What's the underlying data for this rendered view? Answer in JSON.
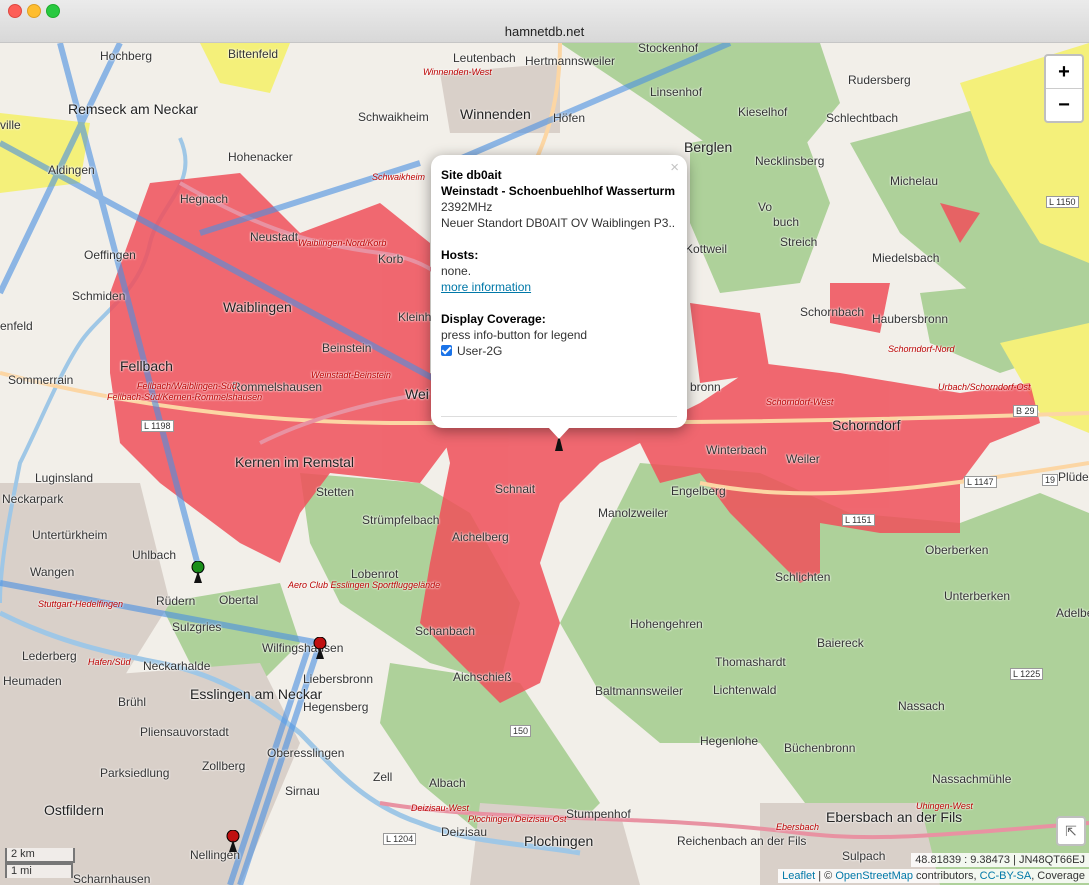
{
  "window": {
    "title": "hamnetdb.net"
  },
  "map": {
    "zoom_in": "+",
    "zoom_out": "−",
    "fullscreen_icon": "expand-icon",
    "places": [
      "Hochberg",
      "Bittenfeld",
      "Leutenbach",
      "Hertmannsweiler",
      "Stockenhof",
      "Rudersberg",
      "Remseck am Neckar",
      "Winnenden",
      "Höfen",
      "Linsenhof",
      "Kieselhof",
      "Schlechtbach",
      "Schwaikheim",
      "Berglen",
      "Necklinsberg",
      "Aldingen",
      "Hohenacker",
      "Michelau",
      "Hegnach",
      "Neustadt",
      "Oeffingen",
      "Schmiden",
      "Waiblingen",
      "Korb",
      "Streich",
      "Miedelsbach",
      "Vo",
      "buch",
      "Kottweil",
      "Kleinh",
      "Schornbach",
      "Haubersbronn",
      "Sommerrain",
      "Fellbach",
      "Beinstein",
      "Rommelshausen",
      "Wei",
      "bronn",
      "Schorndorf",
      "Kernen im Remstal",
      "Winterbach",
      "Weiler",
      "Luginsland",
      "Stetten",
      "Schnait",
      "Engelberg",
      "Untertürkheim",
      "Strümpfelbach",
      "Manolzweiler",
      "Oberberken",
      "Uhlbach",
      "Aichelberg",
      "Schlichten",
      "Wangen",
      "Lobenrot",
      "Rüdern",
      "Obertal",
      "Unterberken",
      "Sulzgries",
      "Hohengehren",
      "Lederberg",
      "Schanbach",
      "Baiereck",
      "Neckarhalde",
      "Wilfingshausen",
      "Thomashardt",
      "Heumaden",
      "Esslingen am Neckar",
      "Liebersbronn",
      "Aichschieß",
      "Baltmannsweiler",
      "Lichtenwald",
      "Nassach",
      "Brühl",
      "Hegensberg",
      "Pliensauvorstadt",
      "Oberesslingen",
      "Hegenlohe",
      "Büchenbronn",
      "Zollberg",
      "Parksiedlung",
      "Sirnau",
      "Zell",
      "Albach",
      "Nassachmühle",
      "Ostfildern",
      "Stumpenhof",
      "Nellingen",
      "Deizisau",
      "Plochingen",
      "Reichenbach an der Fils",
      "Ebersbach an der Fils",
      "Scharnhausen",
      "Sulpach",
      "Plüder",
      "Adelbe",
      "Neckarpark",
      "ville",
      "enfeld"
    ],
    "road_labels": [
      "Winnenden-West",
      "Schwaikheim",
      "Waiblingen-Nord/Korb",
      "Fellbach/Waiblingen-Süd",
      "Fellbach-Süd/Kernen-Rommelshausen",
      "Weinstadt-Beinstein",
      "Schorndorf-Nord",
      "Urbach/Schorndorf-Ost",
      "Schorndorf-West",
      "Stuttgart-Hedelfingen",
      "Hafen/Süd",
      "Aero Club Esslingen Sportfluggelände",
      "Deizisau-West",
      "Plochingen/Deizisau-Ost",
      "Uhingen-West",
      "Ebersbach"
    ],
    "road_numbers": [
      "L 1150",
      "L 1198",
      "L 1147",
      "L 1151",
      "L 1225",
      "L 1204",
      "B 29",
      "150",
      "19"
    ],
    "markers": [
      {
        "name": "site-marker-green",
        "status_color": "#1a8f1a"
      },
      {
        "name": "site-marker-red-1",
        "status_color": "#c01010"
      },
      {
        "name": "site-marker-red-2",
        "status_color": "#c01010"
      },
      {
        "name": "site-marker-db0ait",
        "status_color": "#222222"
      }
    ]
  },
  "popup": {
    "close": "×",
    "site": "Site db0ait",
    "name": "Weinstadt - Schoenbuehlhof Wasserturm",
    "freq": "2392MHz",
    "comment": "Neuer Standort DB0AIT OV Waiblingen P3..",
    "hosts_label": "Hosts:",
    "hosts_value": "none.",
    "more_link": "more information",
    "coverage_label": "Display Coverage:",
    "coverage_hint": "press info-button for legend",
    "coverage_option": "User-2G",
    "coverage_checked": true
  },
  "scale": {
    "metric": "2 km",
    "imperial": "1 mi"
  },
  "coords": "48.81839 : 9.38473 | JN48QT66EJ",
  "attribution": {
    "leaflet": "Leaflet",
    "sep": " | © ",
    "osm": "OpenStreetMap",
    "contrib": " contributors, ",
    "license": "CC-BY-SA",
    "coverage": ", Coverage"
  },
  "colors": {
    "coverage": "#f0505a",
    "forest": "#aed19a",
    "link": "#4a90e2"
  }
}
